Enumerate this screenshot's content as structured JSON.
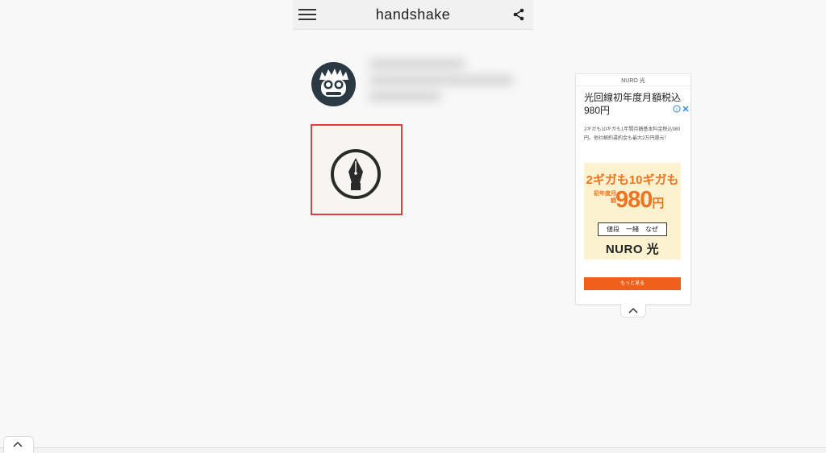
{
  "header": {
    "title": "handshake"
  },
  "icons": {
    "menu": "hamburger-menu-icon",
    "share": "share-icon",
    "avatar": "mascot-face-icon",
    "pen": "fountain-pen-nib-icon",
    "ad_choices": "ad-choices-icon",
    "collapse": "chevron-up-icon"
  },
  "ad": {
    "brand": "NURO 光",
    "headline": "光回線初年度月額税込980円",
    "description": "2ギガも10ギガも1年間月額基本料金税込980円。他社解約違約金も最大2万円還元！",
    "banner": {
      "line1": "2ギガも10ギガも",
      "label_small": "初年度月額",
      "price": "980",
      "price_suffix": "円",
      "tagline": "値段　一緒　なぜ",
      "logo": "NURO 光"
    },
    "cta": "もっと見る"
  },
  "colors": {
    "accent_red": "#e43d3d",
    "ad_orange": "#f0601a",
    "avatar_bg": "#2b3944",
    "banner_bg": "#fdf2d0"
  }
}
